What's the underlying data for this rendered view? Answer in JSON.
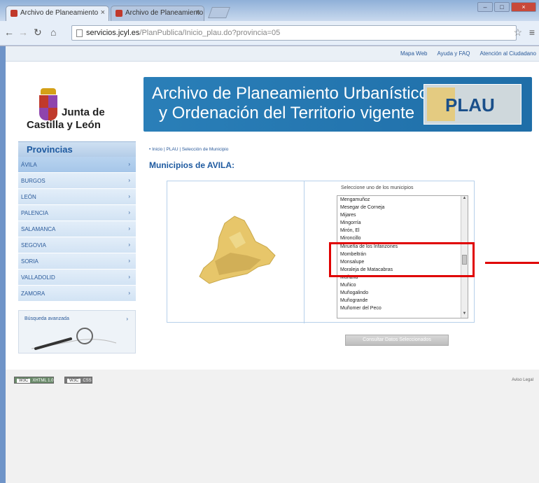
{
  "browser": {
    "tabs": [
      {
        "label": "Archivo de Planeamiento",
        "active": true
      },
      {
        "label": "Archivo de Planeamiento",
        "active": false
      }
    ],
    "url_host": "servicios.jcyl.es",
    "url_path": "/PlanPublica/Inicio_plau.do?provincia=05"
  },
  "top_links": [
    "Mapa Web",
    "Ayuda y FAQ",
    "Atención al Ciudadano"
  ],
  "logo": {
    "line1": "Junta de",
    "line2": "Castilla y León"
  },
  "banner": {
    "line1": "Archivo de Planeamiento Urbanístico",
    "line2": "y Ordenación del Territorio vigente",
    "brand": "PLAU"
  },
  "sidebar": {
    "title": "Provincias",
    "items": [
      {
        "label": "ÁVILA",
        "active": true
      },
      {
        "label": "BURGOS",
        "active": false
      },
      {
        "label": "LEÓN",
        "active": false
      },
      {
        "label": "PALENCIA",
        "active": false
      },
      {
        "label": "SALAMANCA",
        "active": false
      },
      {
        "label": "SEGOVIA",
        "active": false
      },
      {
        "label": "SORIA",
        "active": false
      },
      {
        "label": "VALLADOLID",
        "active": false
      },
      {
        "label": "ZAMORA",
        "active": false
      }
    ],
    "search_label": "Búsqueda avanzada"
  },
  "content": {
    "breadcrumb": "• Inicio | PLAU | Selección de Municipio",
    "heading": "Municipios de AVILA:",
    "list_title": "Seleccione uno de los municipios",
    "municipalities": [
      "Mengamuñoz",
      "Mesegar de Corneja",
      "Mijares",
      "Mingorría",
      "Mirón, El",
      "Mironcillo",
      "Mirueña de los Infanzones",
      "Mombeltrán",
      "Monsalupe",
      "Moraleja de Matacabras",
      "Muñana",
      "Muñico",
      "Muñogalindo",
      "Muñogrande",
      "Muñomer del Peco"
    ],
    "submit_label": "Consultar Datos Seleccionados"
  },
  "footer": {
    "badges": [
      {
        "key": "W3C",
        "label": "XHTML 1.0"
      },
      {
        "key": "W3C",
        "label": "CSS"
      }
    ],
    "legal": "Aviso Legal"
  },
  "colors": {
    "accent": "#1e5aa0",
    "banner": "#2a7fb8",
    "highlight": "#e00000"
  }
}
